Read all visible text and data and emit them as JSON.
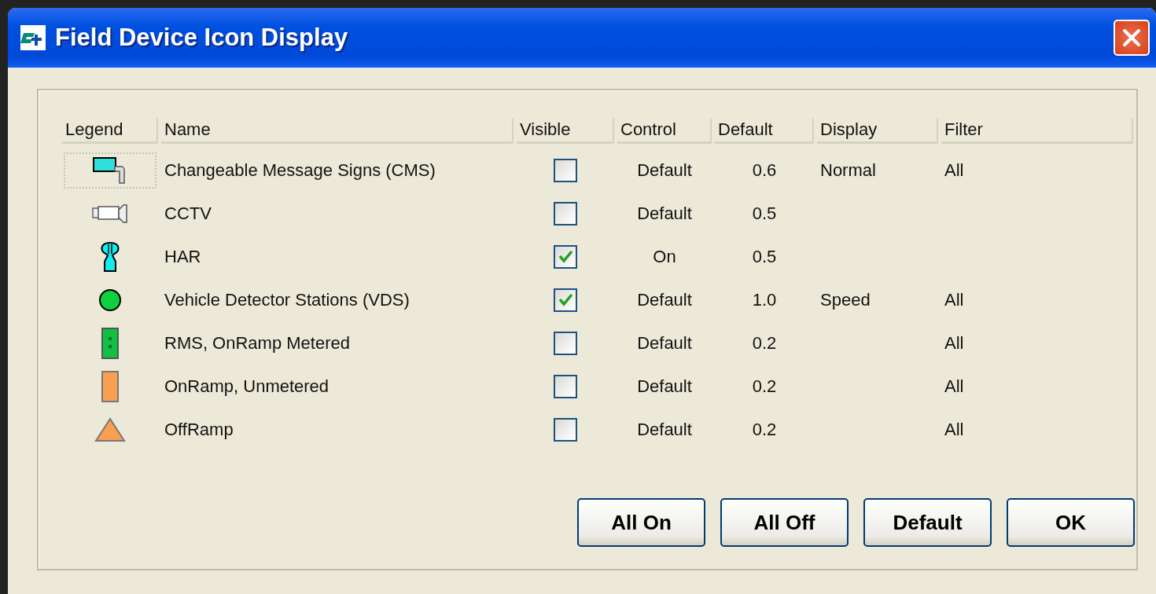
{
  "window": {
    "title": "Field Device Icon Display"
  },
  "table": {
    "columns": [
      "Legend",
      "Name",
      "Visible",
      "Control",
      "Default",
      "Display",
      "Filter"
    ],
    "rows": [
      {
        "kind": "sign",
        "selected": true,
        "name": "Changeable Message Signs (CMS)",
        "visible": false,
        "control": "Default",
        "default": "0.6",
        "display": "Normal",
        "filter": "All"
      },
      {
        "kind": "camera",
        "selected": false,
        "name": "CCTV",
        "visible": false,
        "control": "Default",
        "default": "0.5"
      },
      {
        "kind": "tower",
        "selected": false,
        "name": "HAR",
        "visible": true,
        "control": "On",
        "default": "0.5"
      },
      {
        "kind": "circle",
        "selected": false,
        "name": "Vehicle Detector Stations (VDS)",
        "visible": true,
        "control": "Default",
        "default": "1.0",
        "display": "Speed",
        "filter": "All"
      },
      {
        "kind": "meter",
        "selected": false,
        "name": "RMS, OnRamp Metered",
        "visible": false,
        "control": "Default",
        "default": "0.2",
        "filter": "All"
      },
      {
        "kind": "bar",
        "selected": false,
        "name": "OnRamp, Unmetered",
        "visible": false,
        "control": "Default",
        "default": "0.2",
        "filter": "All"
      },
      {
        "kind": "triangle",
        "selected": false,
        "name": "OffRamp",
        "visible": false,
        "control": "Default",
        "default": "0.2",
        "filter": "All"
      }
    ]
  },
  "buttons": [
    "All On",
    "All Off",
    "Default",
    "OK"
  ]
}
